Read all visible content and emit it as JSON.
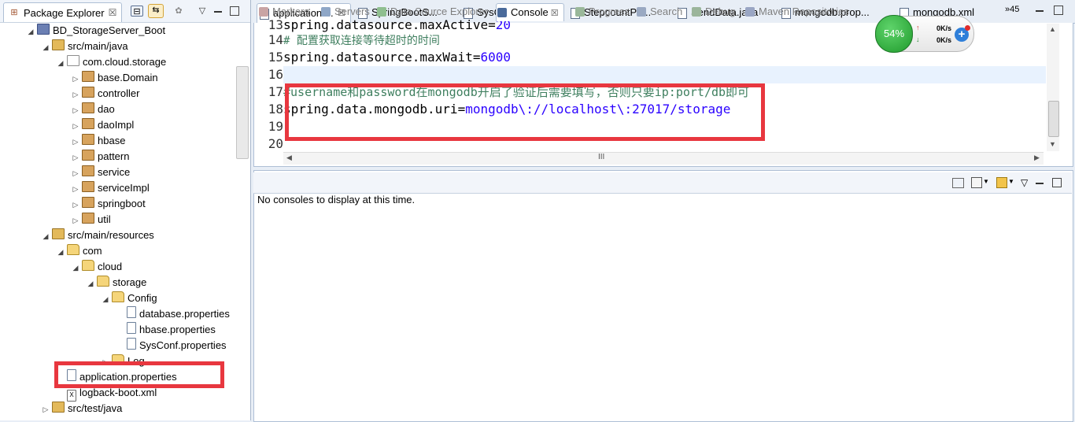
{
  "package_explorer": {
    "title": "Package Explorer",
    "close": "☒",
    "tree": [
      {
        "label": "BD_StorageServer_Boot",
        "icon": "project-icon",
        "twisty": "◢",
        "indent": 0
      },
      {
        "label": "src/main/java",
        "icon": "source-folder-icon",
        "twisty": "◢",
        "indent": 1
      },
      {
        "label": "com.cloud.storage",
        "icon": "package-empty-icon",
        "twisty": "◢",
        "indent": 2
      },
      {
        "label": "base.Domain",
        "icon": "package-icon",
        "twisty": "▷",
        "indent": 3
      },
      {
        "label": "controller",
        "icon": "package-icon",
        "twisty": "▷",
        "indent": 3
      },
      {
        "label": "dao",
        "icon": "package-icon",
        "twisty": "▷",
        "indent": 3
      },
      {
        "label": "daoImpl",
        "icon": "package-icon",
        "twisty": "▷",
        "indent": 3
      },
      {
        "label": "hbase",
        "icon": "package-icon",
        "twisty": "▷",
        "indent": 3
      },
      {
        "label": "pattern",
        "icon": "package-icon",
        "twisty": "▷",
        "indent": 3
      },
      {
        "label": "service",
        "icon": "package-icon",
        "twisty": "▷",
        "indent": 3
      },
      {
        "label": "serviceImpl",
        "icon": "package-icon",
        "twisty": "▷",
        "indent": 3
      },
      {
        "label": "springboot",
        "icon": "package-icon",
        "twisty": "▷",
        "indent": 3
      },
      {
        "label": "util",
        "icon": "package-icon",
        "twisty": "▷",
        "indent": 3
      },
      {
        "label": "src/main/resources",
        "icon": "source-folder-icon",
        "twisty": "◢",
        "indent": 1
      },
      {
        "label": "com",
        "icon": "folder-icon",
        "twisty": "◢",
        "indent": 2
      },
      {
        "label": "cloud",
        "icon": "folder-icon",
        "twisty": "◢",
        "indent": 3
      },
      {
        "label": "storage",
        "icon": "folder-icon",
        "twisty": "◢",
        "indent": 4
      },
      {
        "label": "Config",
        "icon": "folder-icon",
        "twisty": "◢",
        "indent": 5
      },
      {
        "label": "database.properties",
        "icon": "file-icon",
        "twisty": "",
        "indent": 6
      },
      {
        "label": "hbase.properties",
        "icon": "file-icon",
        "twisty": "",
        "indent": 6
      },
      {
        "label": "SysConf.properties",
        "icon": "file-icon",
        "twisty": "",
        "indent": 6
      },
      {
        "label": "Log",
        "icon": "folder-icon",
        "twisty": "▷",
        "indent": 5
      },
      {
        "label": "application.properties",
        "icon": "file-icon",
        "twisty": "",
        "indent": 2
      },
      {
        "label": "logback-boot.xml",
        "icon": "xml-file-icon",
        "twisty": "",
        "indent": 2
      },
      {
        "label": "src/test/java",
        "icon": "source-folder-icon",
        "twisty": "▷",
        "indent": 1
      }
    ]
  },
  "editor": {
    "tabs": [
      {
        "label": "application....",
        "active": true
      },
      {
        "label": "SpringBootS..."
      },
      {
        "label": "SysConf.prop..."
      },
      {
        "label": "StepcountPa..."
      },
      {
        "label": "SendData.java"
      },
      {
        "label": "mongodb.prop..."
      },
      {
        "label": "mongodb.xml"
      }
    ],
    "overflow": "»45",
    "lines": [
      {
        "num": "13",
        "key": "spring.datasource.maxActive",
        "eq": "=",
        "value": "20",
        "comment": ""
      },
      {
        "num": "14",
        "key": "",
        "eq": "",
        "value": "",
        "comment": "# 配置获取连接等待超时的时间"
      },
      {
        "num": "15",
        "key": "spring.datasource.maxWait",
        "eq": "=",
        "value": "6000",
        "comment": ""
      },
      {
        "num": "16",
        "key": "",
        "eq": "",
        "value": "",
        "comment": ""
      },
      {
        "num": "17",
        "key": "",
        "eq": "",
        "value": "",
        "comment": "#username和password在mongodb开启了验证后需要填写，否则只要ip:port/db即可"
      },
      {
        "num": "18",
        "key": "spring.data.mongodb.uri",
        "eq": "=",
        "value": "mongodb\\://localhost\\:27017/storage",
        "comment": ""
      },
      {
        "num": "19",
        "key": "",
        "eq": "",
        "value": "",
        "comment": ""
      },
      {
        "num": "20",
        "key": "",
        "eq": "",
        "value": "",
        "comment": ""
      }
    ],
    "hscroll_grip": "III"
  },
  "speed_widget": {
    "percent": "54%",
    "upload": "0K/s",
    "download": "0K/s"
  },
  "bottom_panel": {
    "tabs": [
      {
        "label": "Markers",
        "icon": "markers-icon"
      },
      {
        "label": "Servers",
        "icon": "servers-icon"
      },
      {
        "label": "Data Source Explorer",
        "icon": "data-source-icon"
      },
      {
        "label": "Console",
        "icon": "console-icon",
        "active": true
      },
      {
        "label": "Progress",
        "icon": "progress-icon"
      },
      {
        "label": "Search",
        "icon": "search-icon"
      },
      {
        "label": "Debug",
        "icon": "debug-icon"
      },
      {
        "label": "Maven Repositories",
        "icon": "maven-icon"
      }
    ],
    "console_message": "No consoles to display at this time."
  },
  "colors": {
    "highlight_box": "#e8373f",
    "comment": "#3f7f5f",
    "string_value": "#2a00ff"
  }
}
